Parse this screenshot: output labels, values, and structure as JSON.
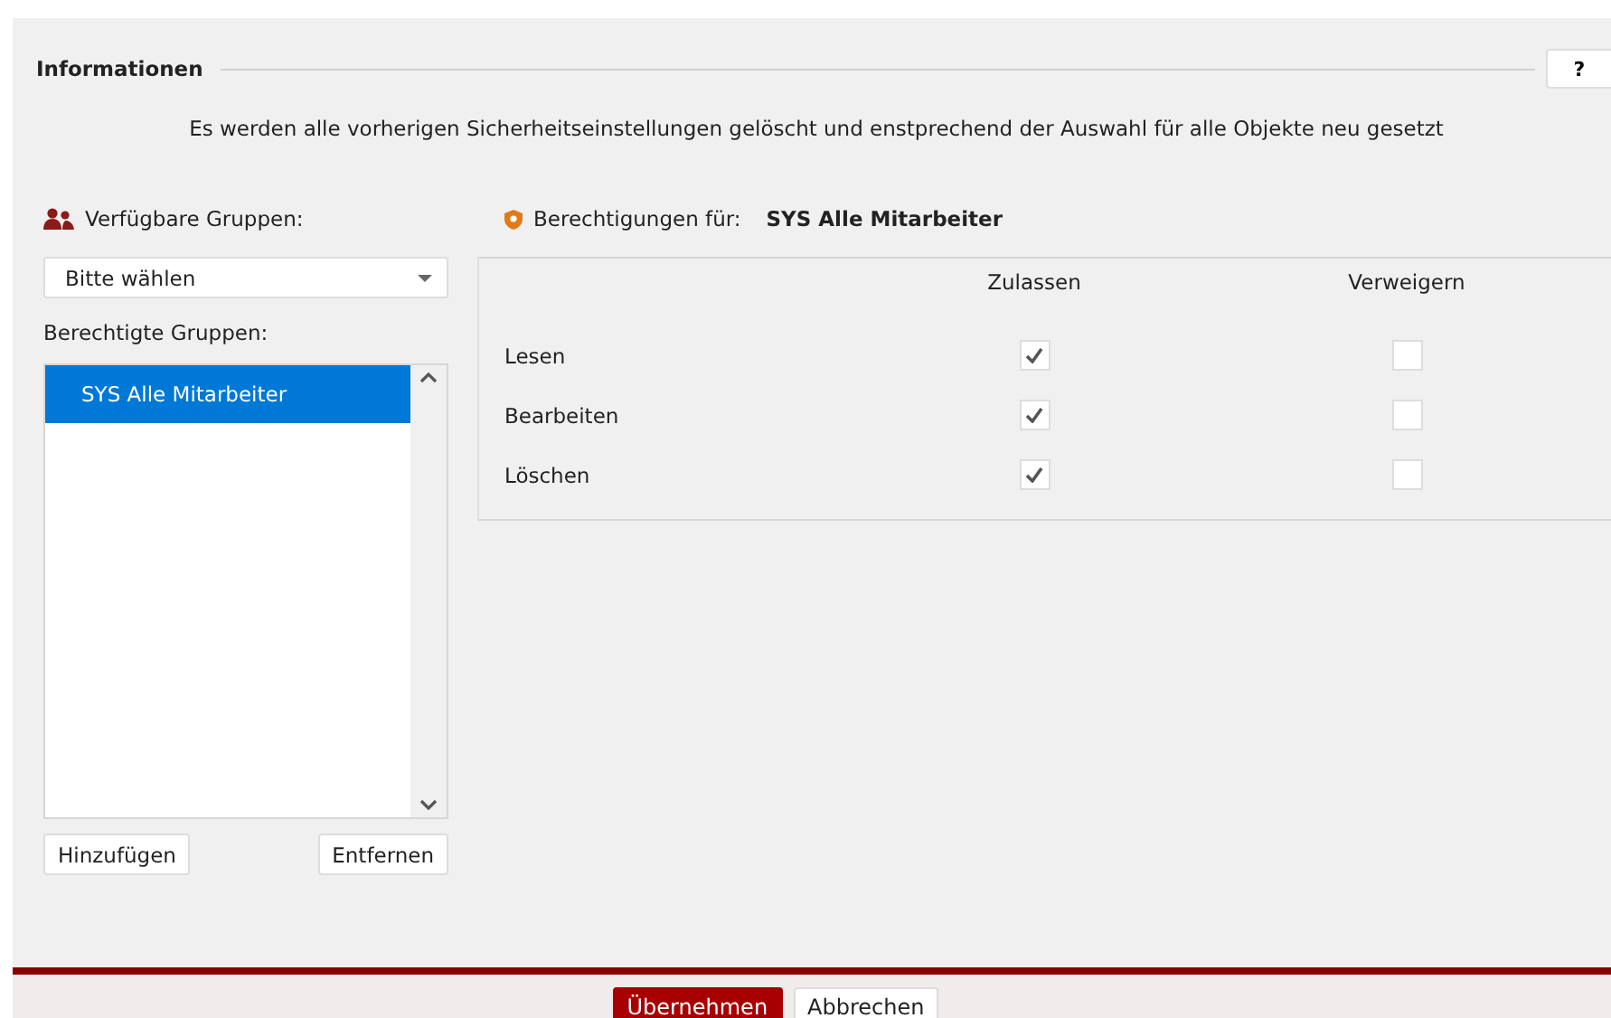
{
  "section": {
    "title": "Informationen",
    "help_button": "?"
  },
  "description": "Es werden alle vorherigen Sicherheitseinstellungen gelöscht und enstprechend der Auswahl für alle Objekte neu gesetzt",
  "available_groups": {
    "label": "Verfügbare Gruppen:",
    "dropdown": {
      "value": "Bitte wählen"
    }
  },
  "authorized_groups": {
    "label": "Berechtigte Gruppen:",
    "items": [
      {
        "name": "SYS Alle Mitarbeiter",
        "selected": true
      }
    ],
    "buttons": [
      "Hinzufügen",
      "Entfernen"
    ]
  },
  "permissions": {
    "label": "Berechtigungen für:",
    "group": "SYS Alle Mitarbeiter",
    "columns": [
      "Zulassen",
      "Verweigern"
    ],
    "rows": [
      {
        "name": "Lesen",
        "allow": true,
        "deny": false
      },
      {
        "name": "Bearbeiten",
        "allow": true,
        "deny": false
      },
      {
        "name": "Löschen",
        "allow": true,
        "deny": false
      }
    ]
  },
  "footer": {
    "buttons": [
      {
        "label": "Übernehmen",
        "kind": "primary"
      },
      {
        "label": "Abbrechen",
        "kind": "secondary"
      }
    ]
  }
}
